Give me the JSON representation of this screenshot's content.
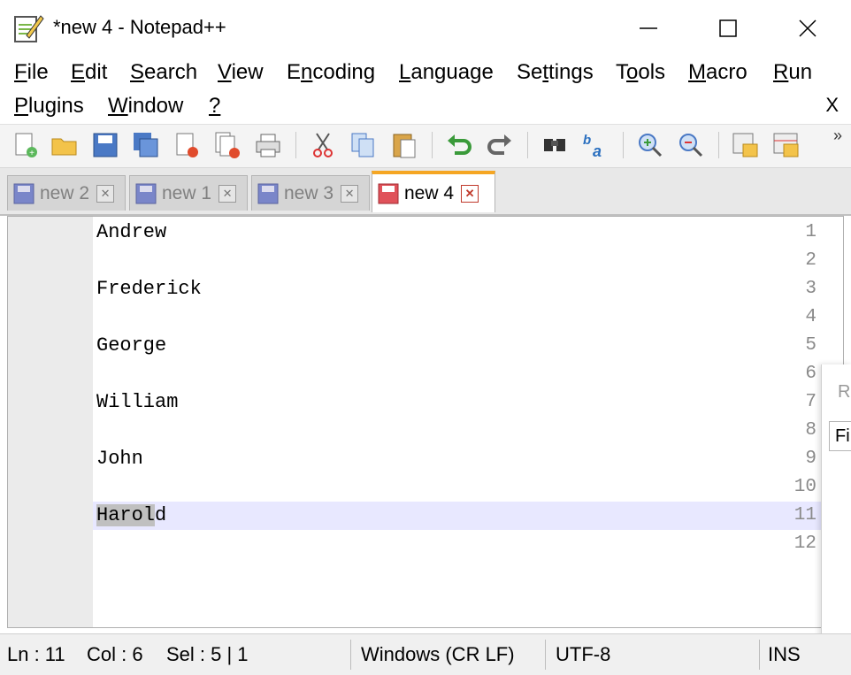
{
  "window": {
    "title": "*new 4 - Notepad++",
    "minimize_glyph": "—",
    "maximize_glyph": "☐",
    "close_glyph": "✕"
  },
  "menu": {
    "row1": [
      "File",
      "Edit",
      "Search",
      "View",
      "Encoding",
      "Language",
      "Settings",
      "Tools",
      "Macro",
      "Run"
    ],
    "row2": [
      "Plugins",
      "Window",
      "?"
    ],
    "close_label": "X"
  },
  "toolbar": {
    "icons": [
      "new-file-icon",
      "open-file-icon",
      "save-icon",
      "save-all-icon",
      "close-icon",
      "close-all-icon",
      "print-icon",
      "cut-icon",
      "copy-icon",
      "paste-icon",
      "undo-icon",
      "redo-icon",
      "find-icon",
      "replace-icon",
      "zoom-in-icon",
      "zoom-out-icon",
      "sync-vertical-icon",
      "sync-horizontal-icon"
    ],
    "more_label": "»"
  },
  "tabs": [
    {
      "label": "new 2",
      "active": false
    },
    {
      "label": "new 1",
      "active": false
    },
    {
      "label": "new 3",
      "active": false
    },
    {
      "label": "new 4",
      "active": true
    }
  ],
  "tab_close_glyph": "✕",
  "editor": {
    "lines": [
      {
        "num": "1",
        "text": "Andrew"
      },
      {
        "num": "2",
        "text": ""
      },
      {
        "num": "3",
        "text": "Frederick"
      },
      {
        "num": "4",
        "text": ""
      },
      {
        "num": "5",
        "text": "George"
      },
      {
        "num": "6",
        "text": ""
      },
      {
        "num": "7",
        "text": "William"
      },
      {
        "num": "8",
        "text": ""
      },
      {
        "num": "9",
        "text": "John"
      },
      {
        "num": "10",
        "text": ""
      },
      {
        "num": "11",
        "text": "Harold"
      },
      {
        "num": "12",
        "text": ""
      }
    ],
    "current_line": 11,
    "selected_text": "Harol",
    "unselected_text": "d"
  },
  "status": {
    "ln": "Ln : 11",
    "col": "Col : 6",
    "sel": "Sel : 5 | 1",
    "eol": "Windows (CR LF)",
    "encoding": "UTF-8",
    "mode": "INS"
  },
  "popup": {
    "text1": "Re",
    "text2": "Fi"
  },
  "colors": {
    "active_tab_accent": "#f5a623",
    "current_line_bg": "#e8e8ff",
    "gutter_bg": "#ebebeb"
  }
}
